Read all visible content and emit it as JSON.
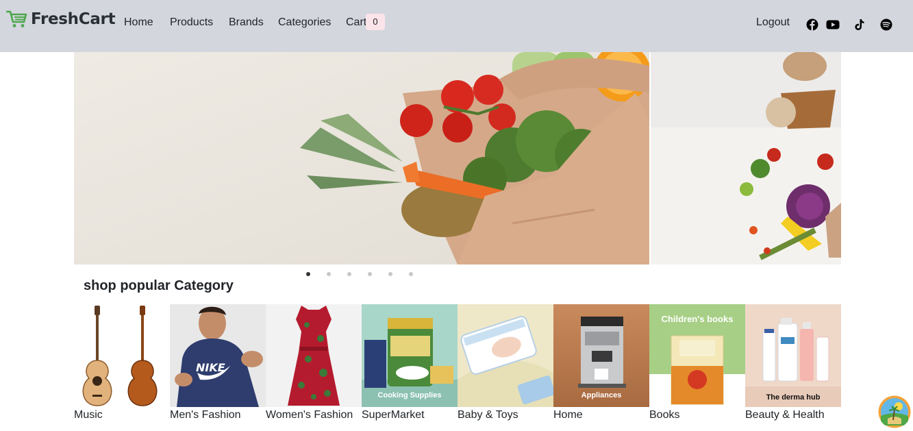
{
  "brand": {
    "name": "FreshCart",
    "icon": "shopping-cart-icon",
    "color": "#4fa74f"
  },
  "nav": {
    "links": [
      "Home",
      "Products",
      "Brands",
      "Categories",
      "Cart"
    ],
    "cart_count": "0",
    "logout": "Logout",
    "social_icons": [
      "facebook-icon",
      "youtube-icon",
      "tiktok-icon",
      "spotify-icon"
    ]
  },
  "hero": {
    "slides": 6,
    "active_slide": 1
  },
  "section": {
    "title": "shop popular Category"
  },
  "categories": [
    {
      "label": "Music",
      "overlay": ""
    },
    {
      "label": "Men's Fashion",
      "overlay": ""
    },
    {
      "label": "Women's Fashion",
      "overlay": ""
    },
    {
      "label": "SuperMarket",
      "overlay": "Cooking Supplies"
    },
    {
      "label": "Baby & Toys",
      "overlay": ""
    },
    {
      "label": "Home",
      "overlay": "Appliances"
    },
    {
      "label": "Books",
      "overlay": "Children's books"
    },
    {
      "label": "Beauty & Health",
      "overlay": "The derma hub"
    }
  ],
  "colors": {
    "navbar_bg": "#d3d6dd",
    "badge_bg": "#fbe4ea",
    "accent": "#4fa74f"
  }
}
